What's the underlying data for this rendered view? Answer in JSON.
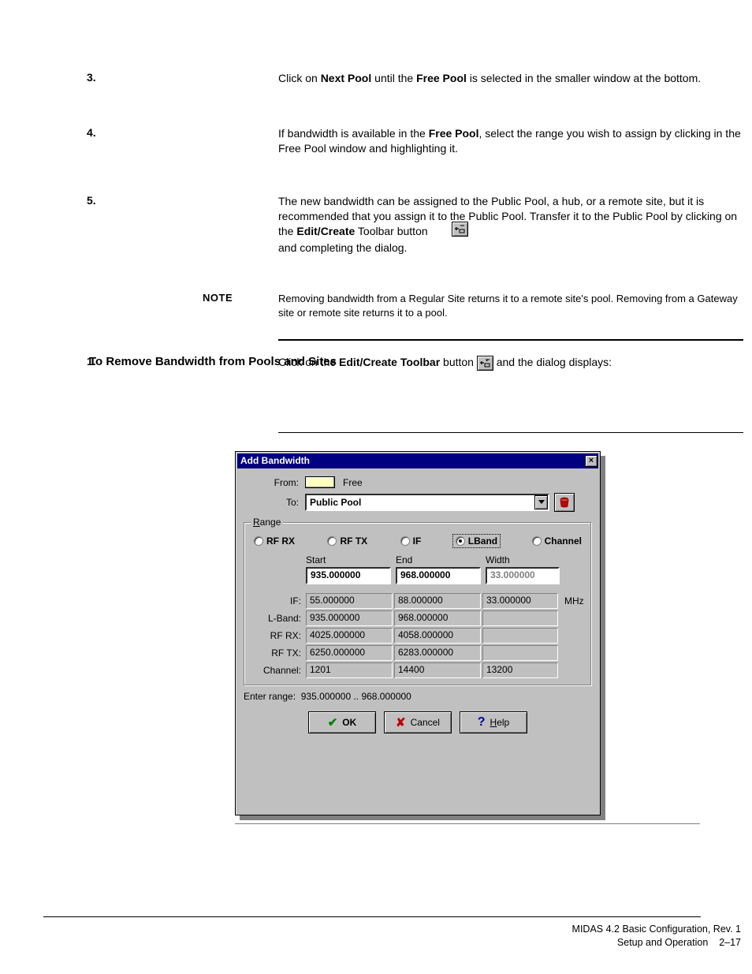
{
  "steps": {
    "s3": {
      "num": "3.",
      "text_a": "Click on ",
      "bold_a": "Next Pool",
      "text_b": " until the ",
      "bold_b": "Free Pool",
      "text_c": " is selected in the smaller window at the bottom."
    },
    "s4": {
      "num": "4.",
      "text_a": "If bandwidth is available in the ",
      "bold_a": "Free Pool",
      "text_b": ", select the range you wish to assign by clicking in the Free Pool window and highlighting it."
    },
    "s5": {
      "num": "5.",
      "text_a": "The new bandwidth can be assigned to the Public Pool, a hub, or a remote site, but it is recommended that you assign it to the Public Pool. Transfer it to the Public Pool by clicking on the ",
      "bold_a": "Edit/Create",
      "text_b": " Toolbar button ",
      "text_c": " and completing the dialog."
    }
  },
  "subhead1": "To Remove Bandwidth from Pools and Sites",
  "para1": {
    "num": "1.",
    "text_a": "Click on the ",
    "bold_a": "Edit/Create Toolbar",
    "text_b": " button ",
    "text_c": " and the dialog displays:"
  },
  "dialog": {
    "title": "Add Bandwidth",
    "from_label": "From:",
    "from_value": "Free",
    "to_label": "To:",
    "to_value": "Public Pool",
    "range_legend": "Range",
    "radios": {
      "rfrx": "RF RX",
      "rftx": "RF TX",
      "iflabel": "IF",
      "lband": "LBand",
      "channel": "Channel"
    },
    "cols": {
      "start": "Start",
      "end": "End",
      "width": "Width"
    },
    "edit": {
      "start": "935.000000",
      "end": "968.000000",
      "width": "33.000000"
    },
    "rows": {
      "if": {
        "label": "IF:",
        "start": "55.000000",
        "end": "88.000000",
        "width": "33.000000"
      },
      "lband": {
        "label": "L-Band:",
        "start": "935.000000",
        "end": "968.000000",
        "width": ""
      },
      "rfrx": {
        "label": "RF RX:",
        "start": "4025.000000",
        "end": "4058.000000",
        "width": ""
      },
      "rftx": {
        "label": "RF TX:",
        "start": "6250.000000",
        "end": "6283.000000",
        "width": ""
      },
      "channel": {
        "label": "Channel:",
        "start": "1201",
        "end": "14400",
        "width": "13200"
      }
    },
    "unit": "MHz",
    "hint_label": "Enter range:",
    "hint_value": "935.000000 .. 968.000000",
    "buttons": {
      "ok": "OK",
      "cancel": "Cancel",
      "help_h": "H",
      "help_rest": "elp"
    }
  },
  "note": {
    "label": "NOTE",
    "text": "Removing bandwidth from a Regular Site returns it to a remote site's pool. Removing from a Gateway site or remote site returns it to a pool."
  },
  "footer": {
    "l1": "MIDAS 4.2 Basic Configuration, Rev. 1",
    "l2a": "Setup and Operation",
    "l2b": "2–17"
  }
}
